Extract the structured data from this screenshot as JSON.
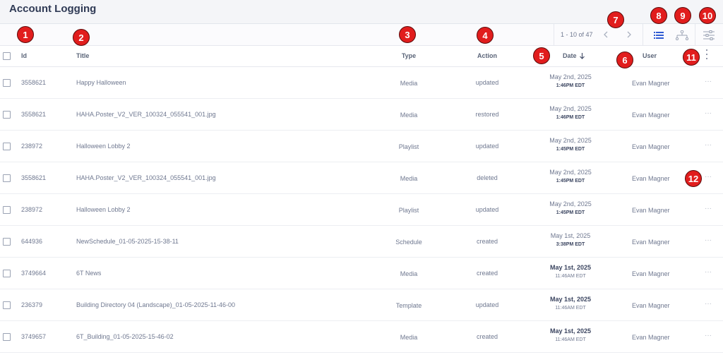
{
  "page": {
    "title": "Account Logging"
  },
  "toolbar": {
    "pager_text": "1 - 10 of 47",
    "prev_icon": "chevron-left-icon",
    "next_icon": "chevron-right-icon",
    "list_view_icon": "list-icon",
    "tree_view_icon": "hierarchy-icon",
    "filter_icon": "sliders-icon"
  },
  "columns": {
    "id": "Id",
    "title": "Title",
    "type": "Type",
    "action": "Action",
    "date": "Date",
    "user": "User"
  },
  "rows": [
    {
      "id": "3558621",
      "title": "Happy Halloween",
      "type": "Media",
      "action": "updated",
      "date": "May 2nd, 2025",
      "time": "1:46PM EDT",
      "user": "Evan Magner",
      "bold_date": false
    },
    {
      "id": "3558621",
      "title": "HAHA.Poster_V2_VER_100324_055541_001.jpg",
      "type": "Media",
      "action": "restored",
      "date": "May 2nd, 2025",
      "time": "1:46PM EDT",
      "user": "Evan Magner",
      "bold_date": false
    },
    {
      "id": "238972",
      "title": "Halloween Lobby 2",
      "type": "Playlist",
      "action": "updated",
      "date": "May 2nd, 2025",
      "time": "1:45PM EDT",
      "user": "Evan Magner",
      "bold_date": false
    },
    {
      "id": "3558621",
      "title": "HAHA.Poster_V2_VER_100324_055541_001.jpg",
      "type": "Media",
      "action": "deleted",
      "date": "May 2nd, 2025",
      "time": "1:45PM EDT",
      "user": "Evan Magner",
      "bold_date": false
    },
    {
      "id": "238972",
      "title": "Halloween Lobby 2",
      "type": "Playlist",
      "action": "updated",
      "date": "May 2nd, 2025",
      "time": "1:45PM EDT",
      "user": "Evan Magner",
      "bold_date": false
    },
    {
      "id": "644936",
      "title": "NewSchedule_01-05-2025-15-38-11",
      "type": "Schedule",
      "action": "created",
      "date": "May 1st, 2025",
      "time": "3:38PM EDT",
      "user": "Evan Magner",
      "bold_date": false
    },
    {
      "id": "3749664",
      "title": "6T News",
      "type": "Media",
      "action": "created",
      "date": "May 1st, 2025",
      "time": "11:46AM EDT",
      "user": "Evan Magner",
      "bold_date": true
    },
    {
      "id": "236379",
      "title": "Building Directory 04 (Landscape)_01-05-2025-11-46-00",
      "type": "Template",
      "action": "updated",
      "date": "May 1st, 2025",
      "time": "11:46AM EDT",
      "user": "Evan Magner",
      "bold_date": true
    },
    {
      "id": "3749657",
      "title": "6T_Building_01-05-2025-15-46-02",
      "type": "Media",
      "action": "created",
      "date": "May 1st, 2025",
      "time": "11:46AM EDT",
      "user": "Evan Magner",
      "bold_date": true
    }
  ],
  "row_menu_label": "···",
  "annotations": [
    "1",
    "2",
    "3",
    "4",
    "5",
    "6",
    "7",
    "8",
    "9",
    "10",
    "11",
    "12"
  ],
  "colors": {
    "marker": "#e11d1d",
    "accent": "#2f5bd3",
    "text": "#6f7890"
  }
}
